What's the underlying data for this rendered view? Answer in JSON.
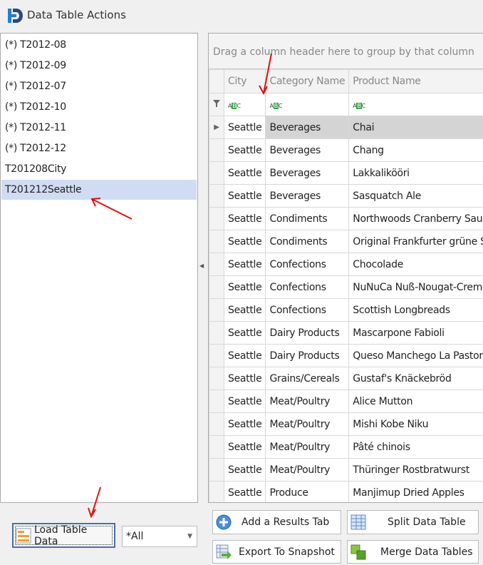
{
  "header": {
    "title": "Data Table Actions"
  },
  "tables": [
    "(*) T2012-08",
    "(*) T2012-09",
    "(*) T2012-07",
    "(*) T2012-10",
    "(*) T2012-11",
    "(*) T2012-12",
    "T201208City",
    "T201212Seattle"
  ],
  "selected_table": "T201212Seattle",
  "grid": {
    "group_hint": "Drag a column header here to group by that column",
    "columns": [
      "City",
      "Category Name",
      "Product Name"
    ],
    "filter_icon_text": "ABC",
    "rows": [
      [
        "Seattle",
        "Beverages",
        "Chai"
      ],
      [
        "Seattle",
        "Beverages",
        "Chang"
      ],
      [
        "Seattle",
        "Beverages",
        "Lakkalikööri"
      ],
      [
        "Seattle",
        "Beverages",
        "Sasquatch Ale"
      ],
      [
        "Seattle",
        "Condiments",
        "Northwoods Cranberry Sauce"
      ],
      [
        "Seattle",
        "Condiments",
        "Original Frankfurter grüne Soße"
      ],
      [
        "Seattle",
        "Confections",
        "Chocolade"
      ],
      [
        "Seattle",
        "Confections",
        "NuNuCa Nuß-Nougat-Creme"
      ],
      [
        "Seattle",
        "Confections",
        "Scottish Longbreads"
      ],
      [
        "Seattle",
        "Dairy Products",
        "Mascarpone Fabioli"
      ],
      [
        "Seattle",
        "Dairy Products",
        "Queso Manchego La Pastora"
      ],
      [
        "Seattle",
        "Grains/Cereals",
        "Gustaf's Knäckebröd"
      ],
      [
        "Seattle",
        "Meat/Poultry",
        "Alice Mutton"
      ],
      [
        "Seattle",
        "Meat/Poultry",
        "Mishi Kobe Niku"
      ],
      [
        "Seattle",
        "Meat/Poultry",
        "Pâté chinois"
      ],
      [
        "Seattle",
        "Meat/Poultry",
        "Thüringer Rostbratwurst"
      ],
      [
        "Seattle",
        "Produce",
        "Manjimup Dried Apples"
      ]
    ]
  },
  "bottom": {
    "load_label": "Load Table Data",
    "filter_value": "*All",
    "add_tab_label": "Add a Results Tab",
    "split_label": "Split Data Table",
    "export_label": "Export To Snapshot",
    "merge_label": "Merge Data Tables"
  }
}
